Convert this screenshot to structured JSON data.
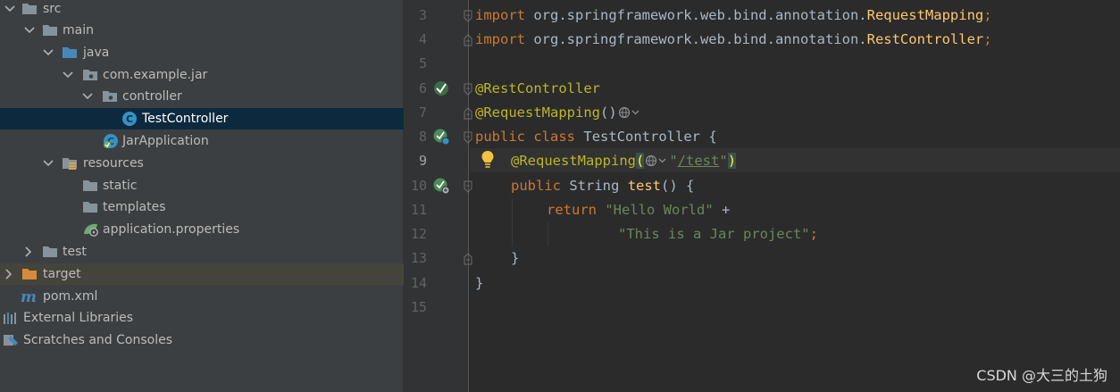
{
  "tree": {
    "items": [
      {
        "label": "src",
        "icon": "folder-icon"
      },
      {
        "label": "main",
        "icon": "folder-icon"
      },
      {
        "label": "java",
        "icon": "source-folder-icon"
      },
      {
        "label": "com.example.jar",
        "icon": "package-icon"
      },
      {
        "label": "controller",
        "icon": "package-icon"
      },
      {
        "label": "TestController",
        "icon": "class-icon"
      },
      {
        "label": "JarApplication",
        "icon": "spring-boot-class-icon"
      },
      {
        "label": "resources",
        "icon": "resources-folder-icon"
      },
      {
        "label": "static",
        "icon": "folder-icon"
      },
      {
        "label": "templates",
        "icon": "folder-icon"
      },
      {
        "label": "application.properties",
        "icon": "spring-properties-icon"
      },
      {
        "label": "test",
        "icon": "folder-icon"
      },
      {
        "label": "target",
        "icon": "excluded-folder-icon"
      },
      {
        "label": "pom.xml",
        "icon": "maven-icon"
      },
      {
        "label": "External Libraries",
        "icon": "libraries-icon"
      },
      {
        "label": "Scratches and Consoles",
        "icon": "scratches-icon"
      }
    ]
  },
  "editor": {
    "line_numbers": [
      "3",
      "4",
      "5",
      "6",
      "7",
      "8",
      "9",
      "10",
      "11",
      "12",
      "13",
      "14",
      "15"
    ],
    "current_line": "9",
    "code": {
      "l3": {
        "kw": "import",
        "pkg": " org.springframework.web.bind.annotation.",
        "cls": "RequestMapping",
        "semi": ";"
      },
      "l4": {
        "kw": "import",
        "pkg": " org.springframework.web.bind.annotation.",
        "cls": "RestController",
        "semi": ";"
      },
      "l6": {
        "ann": "@RestController"
      },
      "l7": {
        "ann": "@RequestMapping",
        "paren": "()"
      },
      "l8": {
        "kw1": "public",
        "kw2": "class",
        "name": "TestController",
        "brace": "{"
      },
      "l9": {
        "ann": "@RequestMapping",
        "open": "(",
        "str_q1": "\"",
        "str_path": "/test",
        "str_q2": "\"",
        "close": ")"
      },
      "l10": {
        "kw": "public",
        "type": "String",
        "fn": "test",
        "rest": "() {"
      },
      "l11": {
        "kw": "return",
        "str": "\"Hello World\"",
        "op": " +"
      },
      "l12": {
        "str": "\"This is a Jar project\"",
        "semi": ";"
      },
      "l13": {
        "brace": "}"
      },
      "l14": {
        "brace": "}"
      }
    }
  },
  "watermark": "CSDN @大三的土狗"
}
